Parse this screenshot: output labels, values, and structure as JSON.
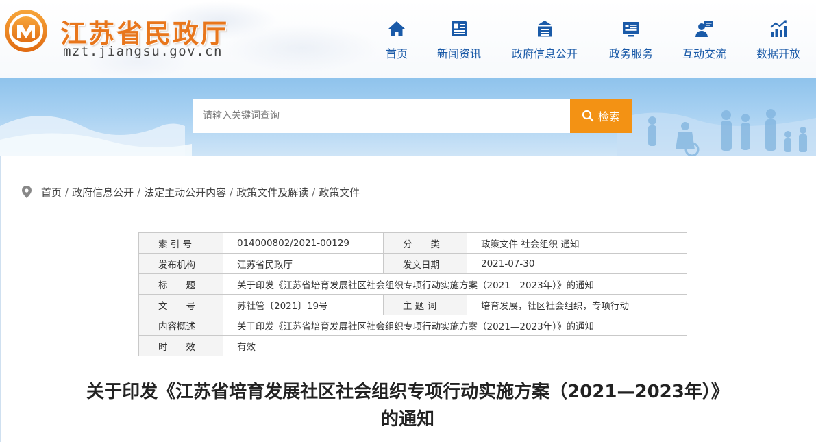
{
  "site": {
    "title": "江苏省民政厅",
    "domain": "mzt.jiangsu.gov.cn"
  },
  "nav": [
    {
      "label": "首页",
      "icon": "home-icon"
    },
    {
      "label": "新闻资讯",
      "icon": "news-icon"
    },
    {
      "label": "政府信息公开",
      "icon": "government-info-icon"
    },
    {
      "label": "政务服务",
      "icon": "service-monitor-icon"
    },
    {
      "label": "互动交流",
      "icon": "chat-person-icon"
    },
    {
      "label": "数据开放",
      "icon": "chart-icon"
    }
  ],
  "search": {
    "placeholder": "请输入关键词查询",
    "button_label": "检索"
  },
  "breadcrumb": [
    "首页",
    "政府信息公开",
    "法定主动公开内容",
    "政策文件及解读",
    "政策文件"
  ],
  "info": {
    "index_label": "索 引 号",
    "index_value": "014000802/2021-00129",
    "category_label": "分　　类",
    "category_value": "政策文件 社会组织 通知",
    "publisher_label": "发布机构",
    "publisher_value": "江苏省民政厅",
    "date_label": "发文日期",
    "date_value": "2021-07-30",
    "title_label": "标　　题",
    "title_value": "关于印发《江苏省培育发展社区社会组织专项行动实施方案（2021—2023年）》的通知",
    "docno_label": "文　　号",
    "docno_value": "苏社管〔2021〕19号",
    "keywords_label": "主 题 词",
    "keywords_value": "培育发展，社区社会组织，专项行动",
    "summary_label": "内容概述",
    "summary_value": "关于印发《江苏省培育发展社区社会组织专项行动实施方案（2021—2023年）》的通知",
    "validity_label": "时　　效",
    "validity_value": "有效"
  },
  "article": {
    "title": "关于印发《江苏省培育发展社区社会组织专项行动实施方案（2021—2023年）》的通知"
  },
  "colors": {
    "brand_orange": "#e8761c",
    "nav_blue": "#1a5aa8",
    "search_button": "#f39214",
    "banner_blue": "#a8d1f2"
  }
}
